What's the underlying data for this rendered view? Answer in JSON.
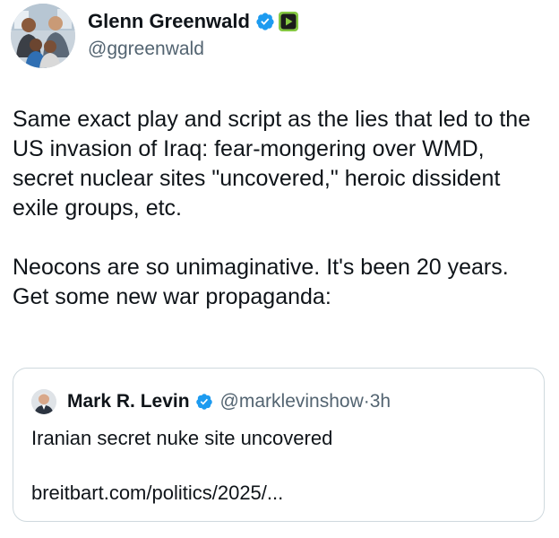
{
  "author": {
    "display_name": "Glenn Greenwald",
    "handle": "@ggreenwald",
    "verified_icon": "verified-badge-icon",
    "affiliate_icon": "rumble-play-icon",
    "colors": {
      "verified": "#1d9bf0",
      "affiliate_bg": "#85c742"
    }
  },
  "tweet": {
    "paragraphs": [
      "Same exact play and script as the lies that led to the US invasion of Iraq: fear-mongering over WMD, secret nuclear sites \"uncovered,\" heroic dissident exile groups, etc.",
      "Neocons are so unimaginative. It's been 20 years. Get some new war propaganda:"
    ]
  },
  "quote": {
    "display_name": "Mark R. Levin",
    "handle": "@marklevinshow",
    "separator": "·",
    "time": "3h",
    "text": "Iranian secret nuke site uncovered",
    "link": "breitbart.com/politics/2025/..."
  }
}
